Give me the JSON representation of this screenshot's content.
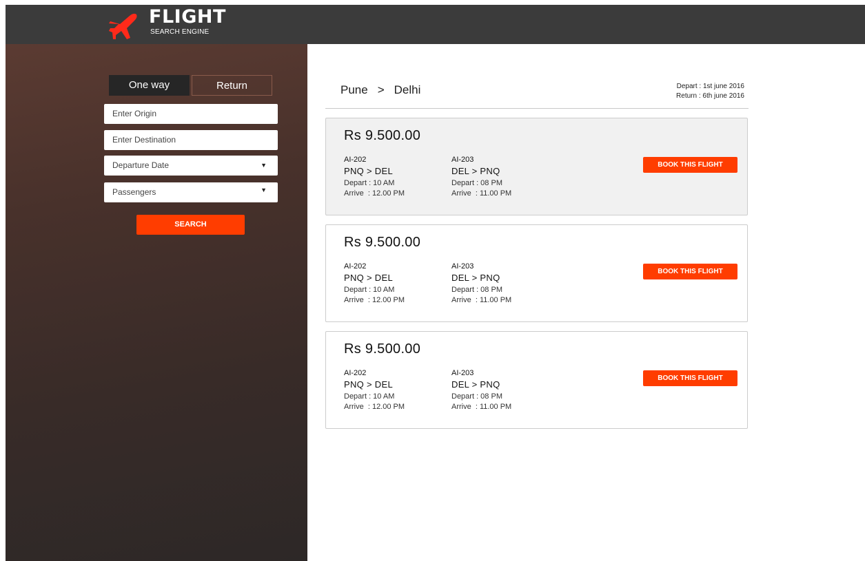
{
  "header": {
    "title": "FLIGHT",
    "subtitle": "SEARCH ENGINE",
    "logo_icon": "airplane-icon",
    "background": "#3b3b3b"
  },
  "sidebar": {
    "trip_type": {
      "one_way": "One way",
      "return": "Return",
      "selected": "One way"
    },
    "origin_placeholder": "Enter Origin",
    "destination_placeholder": "Enter Destination",
    "departure_date_label": "Departure Date",
    "passengers_label": "Passengers",
    "dropdown_icon": "triangle-down-icon",
    "search_label": "SEARCH",
    "accent": "#ff3d00"
  },
  "results": {
    "origin": "Pune",
    "separator": ">",
    "destination": "Delhi",
    "depart_date": "Depart : 1st june 2016",
    "return_date": "Return : 6th june 2016",
    "flights": [
      {
        "price": "Rs 9.500.00",
        "outbound": {
          "code": "AI-202",
          "route": "PNQ > DEL",
          "depart": "Depart : 10 AM",
          "arrive": "Arrive  : 12.00 PM"
        },
        "inbound": {
          "code": "AI-203",
          "route": "DEL > PNQ",
          "depart": "Depart : 08 PM",
          "arrive": "Arrive  : 11.00 PM"
        },
        "book_label": "BOOK THIS FLIGHT"
      },
      {
        "price": "Rs 9.500.00",
        "outbound": {
          "code": "AI-202",
          "route": "PNQ > DEL",
          "depart": "Depart : 10 AM",
          "arrive": "Arrive  : 12.00 PM"
        },
        "inbound": {
          "code": "AI-203",
          "route": "DEL > PNQ",
          "depart": "Depart : 08 PM",
          "arrive": "Arrive  : 11.00 PM"
        },
        "book_label": "BOOK THIS FLIGHT"
      },
      {
        "price": "Rs 9.500.00",
        "outbound": {
          "code": "AI-202",
          "route": "PNQ > DEL",
          "depart": "Depart : 10 AM",
          "arrive": "Arrive  : 12.00 PM"
        },
        "inbound": {
          "code": "AI-203",
          "route": "DEL > PNQ",
          "depart": "Depart : 08 PM",
          "arrive": "Arrive  : 11.00 PM"
        },
        "book_label": "BOOK THIS FLIGHT"
      }
    ]
  }
}
